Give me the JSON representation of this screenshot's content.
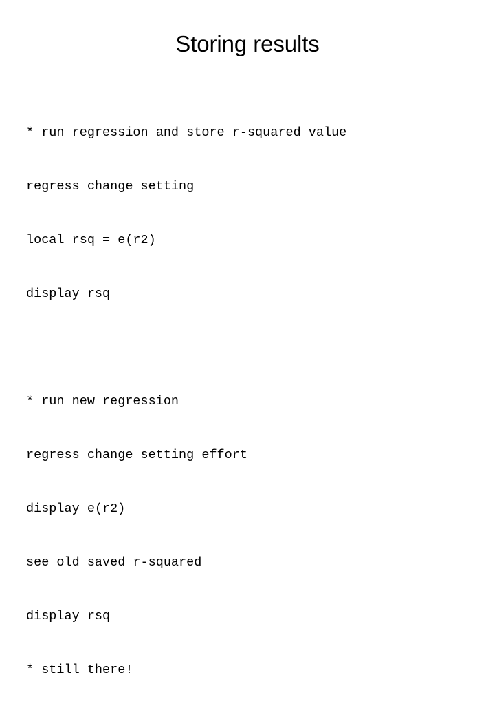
{
  "slide": {
    "title": "Storing results",
    "background_color": "#ffffff",
    "text_color": "#000000",
    "blocks": [
      {
        "name": "first-code-block",
        "lines": [
          "* run regression and store r-squared value",
          "regress change setting",
          "local rsq = e(r2)",
          "display rsq"
        ]
      },
      {
        "name": "second-code-block",
        "lines": [
          "* run new regression",
          "regress change setting effort",
          "display e(r2)",
          "see old saved r-squared",
          "display rsq",
          "* still there!"
        ]
      }
    ]
  }
}
